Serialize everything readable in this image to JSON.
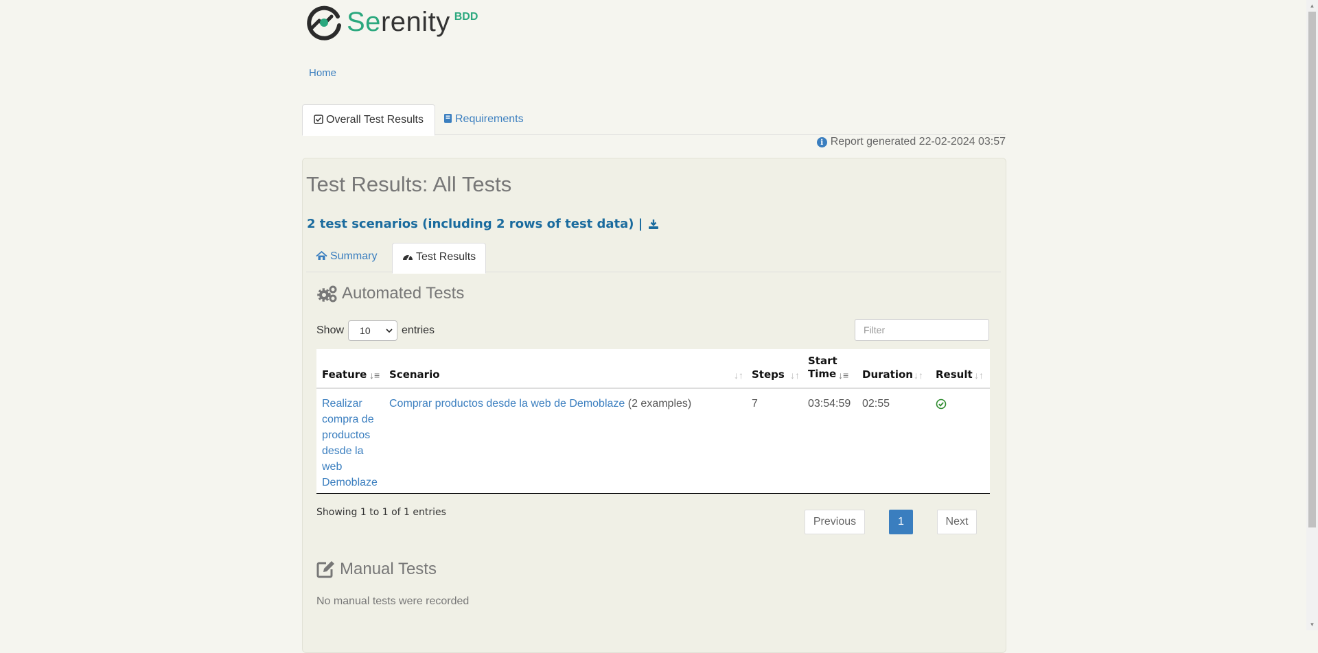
{
  "brand": {
    "name_prefix": "Se",
    "name_rest": "renity",
    "suffix": "BDD"
  },
  "breadcrumb": {
    "home": "Home"
  },
  "top_tabs": {
    "overall": "Overall Test Results",
    "requirements": "Requirements"
  },
  "report": {
    "generated": "Report generated 22-02-2024 03:57"
  },
  "panel": {
    "title": "Test Results: All Tests",
    "scenario_count": "2 test scenarios (including 2 rows of test data) |"
  },
  "sub_tabs": {
    "summary": "Summary",
    "results": "Test Results"
  },
  "automated": {
    "heading": "Automated Tests",
    "show_label": "Show",
    "entries_label": "entries",
    "page_size": "10",
    "filter_placeholder": "Filter",
    "columns": {
      "feature": "Feature",
      "scenario": "Scenario",
      "steps": "Steps",
      "start_time": "Start Time",
      "duration": "Duration",
      "result": "Result"
    },
    "rows": [
      {
        "feature": "Realizar compra de productos desde la web Demoblaze",
        "scenario": "Comprar productos desde la web de Demoblaze",
        "examples": "(2 examples)",
        "steps": "7",
        "start_time": "03:54:59",
        "duration": "02:55",
        "result": "passed"
      }
    ],
    "showing": "Showing 1 to 1 of 1 entries",
    "pagination": {
      "previous": "Previous",
      "page": "1",
      "next": "Next"
    }
  },
  "manual": {
    "heading": "Manual Tests",
    "empty": "No manual tests were recorded"
  },
  "colors": {
    "brand_green": "#2ba87e",
    "link_blue": "#3a7ebf",
    "title_blue": "#1a6b9e",
    "pass_green": "#2e8b2e"
  }
}
